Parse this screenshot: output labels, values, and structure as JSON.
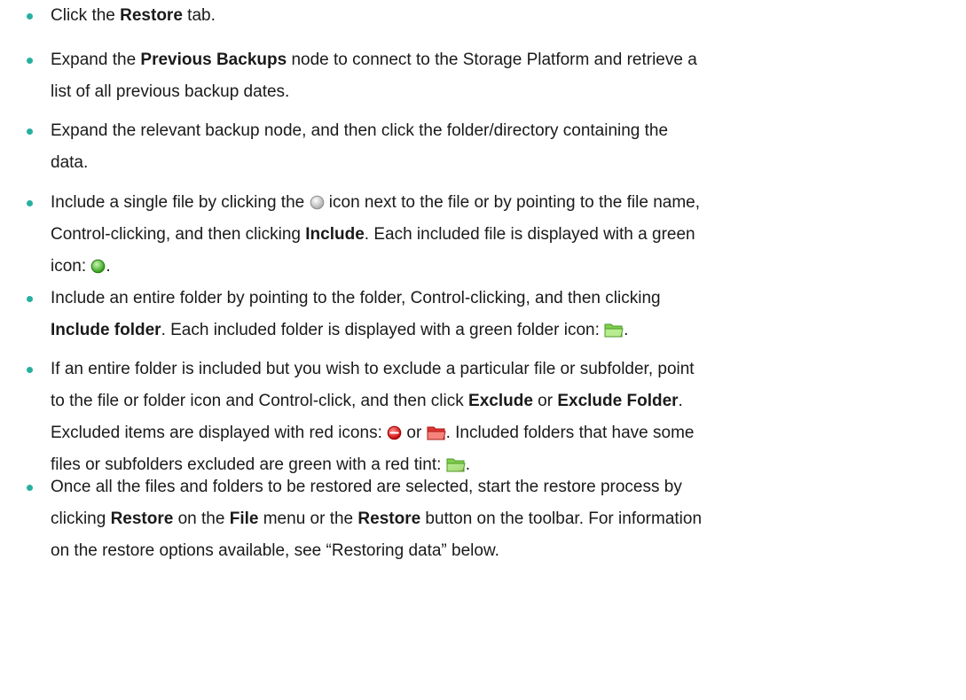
{
  "steps": [
    {
      "lines": [
        [
          {
            "t": "Click the "
          },
          {
            "t": "Restore",
            "b": true
          },
          {
            "t": " tab."
          }
        ]
      ]
    },
    {
      "lines": [
        [
          {
            "t": "Expand the "
          },
          {
            "t": "Previous Backups",
            "b": true
          },
          {
            "t": " node to connect to the Storage Platform and retrieve a"
          }
        ],
        [
          {
            "t": "list of all previous backup dates."
          }
        ]
      ]
    },
    {
      "lines": [
        [
          {
            "t": "Expand the relevant backup node, and then click the folder/directory containing the"
          }
        ],
        [
          {
            "t": "data."
          }
        ]
      ]
    },
    {
      "lines": [
        [
          {
            "t": "Include a single file by clicking the "
          },
          {
            "i": "grey-circle-icon"
          },
          {
            "t": " icon next to the file or by pointing to the file name,"
          }
        ],
        [
          {
            "t": "Control-clicking, and then clicking "
          },
          {
            "t": "Include",
            "b": true
          },
          {
            "t": ".  Each included file is displayed with a green"
          }
        ],
        [
          {
            "t": "icon: "
          },
          {
            "i": "green-circle-icon"
          },
          {
            "t": "."
          }
        ]
      ]
    },
    {
      "lines": [
        [
          {
            "t": "Include an entire folder by pointing to the folder, Control-clicking, and then clicking"
          }
        ],
        [
          {
            "t": "Include folder",
            "b": true
          },
          {
            "t": ".  Each included folder is displayed with a green folder icon: "
          },
          {
            "i": "green-folder-icon"
          },
          {
            "t": "."
          }
        ]
      ]
    },
    {
      "lines": [
        [
          {
            "t": "If an entire folder is included but you wish to exclude a particular file or subfolder, point"
          }
        ],
        [
          {
            "t": "to the file or folder icon and Control-click, and then click "
          },
          {
            "t": "Exclude",
            "b": true
          },
          {
            "t": " or "
          },
          {
            "t": "Exclude Folder",
            "b": true
          },
          {
            "t": "."
          }
        ],
        [
          {
            "t": "Excluded items are displayed with red icons: "
          },
          {
            "i": "red-circle-icon"
          },
          {
            "t": " or "
          },
          {
            "i": "red-folder-icon"
          },
          {
            "t": ". Included folders that have some"
          }
        ],
        [
          {
            "t": "files or subfolders excluded are green with a red tint: "
          },
          {
            "i": "tinted-folder-icon"
          },
          {
            "t": "."
          }
        ]
      ]
    },
    {
      "lines": [
        [
          {
            "t": "Once all the files and folders to be restored are selected, start the restore process by"
          }
        ],
        [
          {
            "t": "clicking "
          },
          {
            "t": "Restore",
            "b": true
          },
          {
            "t": " on the "
          },
          {
            "t": "File",
            "b": true
          },
          {
            "t": " menu or the "
          },
          {
            "t": "Restore",
            "b": true
          },
          {
            "t": " button on the toolbar. For information"
          }
        ],
        [
          {
            "t": "on the restore options available, see “Restoring data” below."
          }
        ]
      ]
    }
  ]
}
